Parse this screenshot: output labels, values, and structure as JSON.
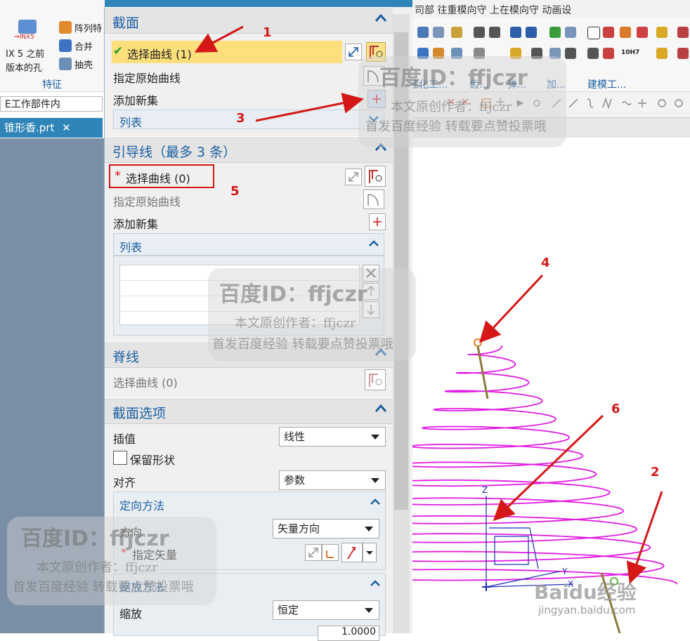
{
  "ribbon_left": {
    "nx5_icon_label": "⇒INX5",
    "btn_array": "阵列特",
    "btn_union": "合并",
    "btn_shell": "抽壳",
    "nx5_text_1": "IX 5 之前",
    "nx5_text_2": "版本的孔",
    "group_label": "特征",
    "work_part_filter": "E工作部件内",
    "file_tab": "锥形香.prt"
  },
  "ribbon_right": {
    "top_menu": "司部   往重模向守   上在模向守   动画设",
    "group_labels": [
      "佳化工...",
      "齿...",
      "弹...",
      "加...",
      "建模工..."
    ],
    "icon_10h7": "10H7"
  },
  "dialog": {
    "section": {
      "title": "截面",
      "select_curve": "选择曲线 (1)",
      "specify_origin": "指定原始曲线",
      "add_new_set": "添加新集",
      "list": "列表"
    },
    "guide": {
      "title": "引导线（最多 3 条）",
      "required_mark": "*",
      "select_curve": "选择曲线 (0)",
      "specify_origin": "指定原始曲线",
      "add_new_set": "添加新集",
      "list": "列表"
    },
    "spine": {
      "title": "脊线",
      "select_curve": "选择曲线 (0)"
    },
    "section_options": {
      "title": "截面选项",
      "interp_label": "插值",
      "interp_value": "线性",
      "keep_shape": "保留形状",
      "align_label": "对齐",
      "align_value": "参数",
      "orient_title": "定向方法",
      "direction_label": "方向",
      "direction_value": "矢量方向",
      "specify_vector": "指定矢量",
      "scale_title": "缩放方法",
      "scale_label": "缩放",
      "scale_value": "恒定",
      "ratio_value": "1.0000"
    }
  },
  "annotations": [
    "1",
    "2",
    "3",
    "4",
    "5",
    "6"
  ],
  "watermark": {
    "title": "百度ID：ffjczr",
    "line1": "本文原创作者：ffjczr",
    "line2": "首发百度经验  转载要点赞投票哦",
    "baidu_brand": "Baidu经验",
    "baidu_url": "jingyan.baidu.com"
  },
  "axis_labels": {
    "z": "Z",
    "y": "Y",
    "x": "X"
  },
  "colors": {
    "accent": "#1d5fa3",
    "highlight": "#fde07b",
    "annotation": "#d41818",
    "helix": "#e21ce2",
    "title_bar": "#2f84b8"
  }
}
